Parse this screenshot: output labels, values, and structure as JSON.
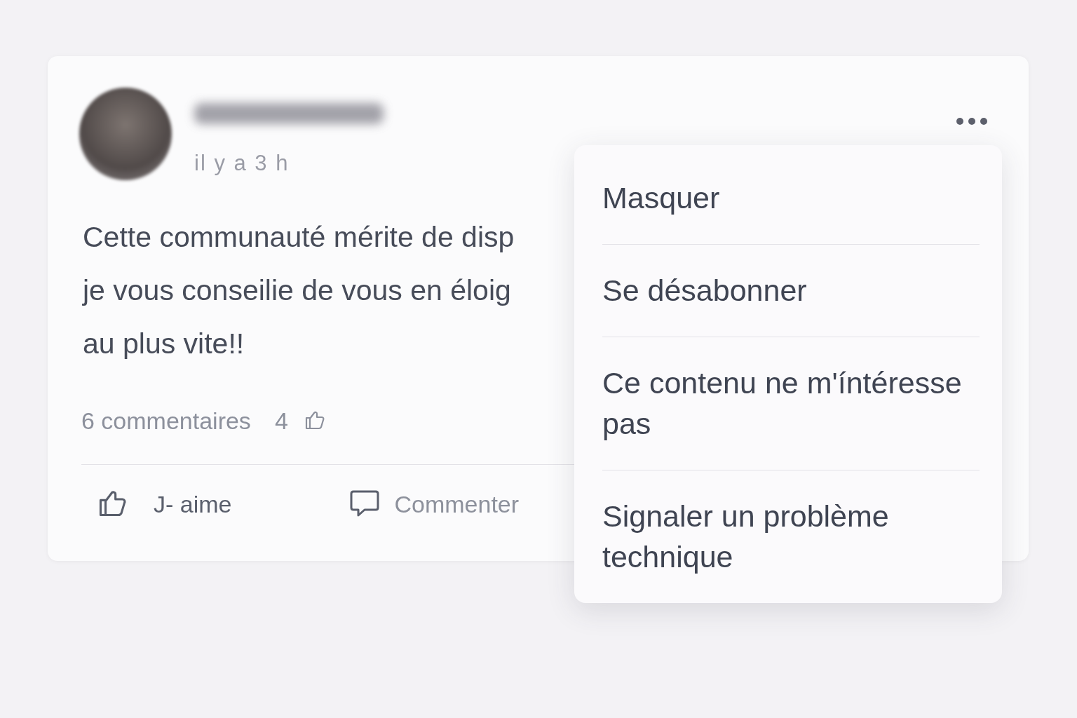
{
  "post": {
    "time": "il y a 3 h",
    "text_lines": [
      "Cette communauté mérite de disp",
      "je vous conseilie de vous en éloig",
      "au plus vite!!"
    ],
    "comments_count": "6 commentaires",
    "likes_count": "4",
    "actions": [
      {
        "kind": "like",
        "label": "J- aime"
      },
      {
        "kind": "comment",
        "label": "Commenter"
      }
    ]
  },
  "menu": {
    "open": true,
    "items": [
      "Masquer",
      "Se désabonner",
      "Ce contenu ne m'íntéresse pas",
      "Signaler un problème technique"
    ]
  }
}
